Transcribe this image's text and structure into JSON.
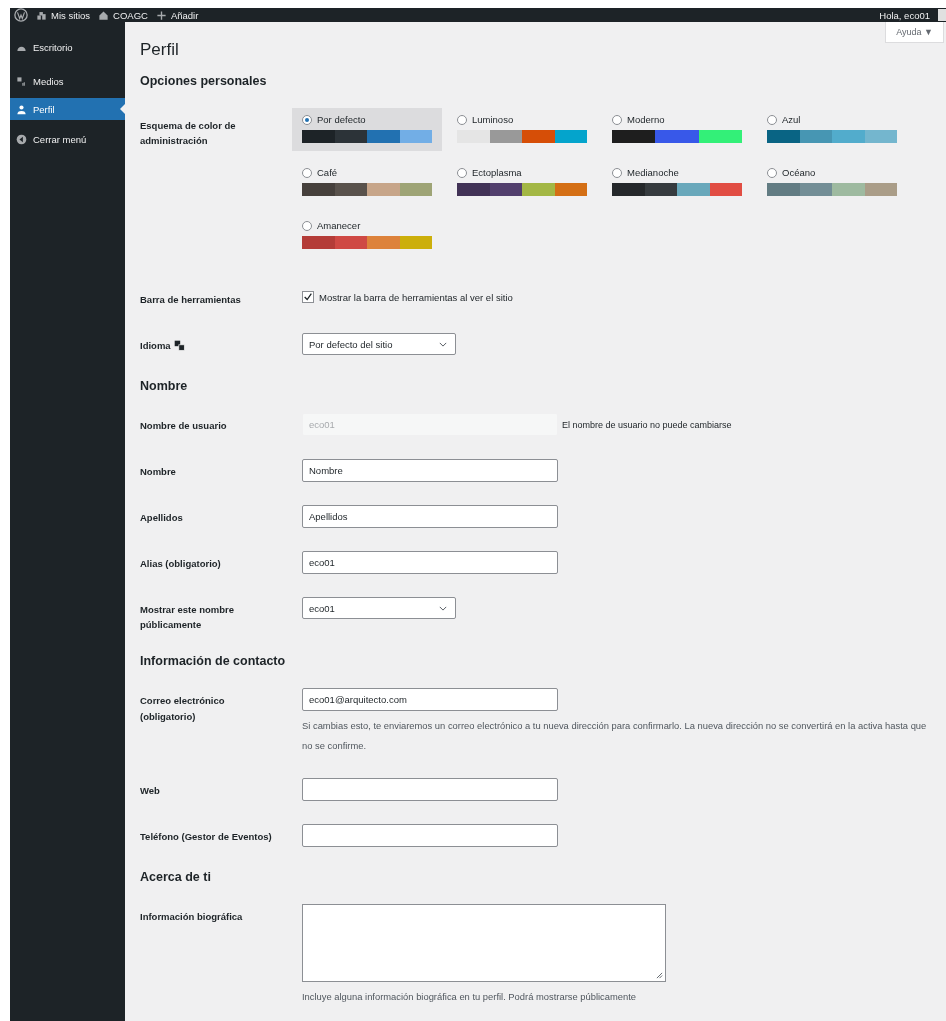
{
  "admin_bar": {
    "items": [
      {
        "kind": "wp"
      },
      {
        "kind": "sites",
        "label": "Mis sitios"
      },
      {
        "kind": "home",
        "label": "COAGC"
      },
      {
        "kind": "add",
        "label": "Añadir"
      }
    ],
    "greeting": "Hola, eco01"
  },
  "sidebar": {
    "items": [
      {
        "kind": "dashboard",
        "label": "Escritorio",
        "selected": false
      },
      {
        "kind": "media",
        "label": "Medios",
        "selected": false
      },
      {
        "kind": "user",
        "label": "Perfil",
        "selected": true
      },
      {
        "kind": "collapse",
        "label": "Cerrar menú",
        "selected": false
      }
    ]
  },
  "help_button": "Ayuda ▼",
  "title": "Perfil",
  "sections": [
    {
      "title": "Opciones personales",
      "rows": [
        {
          "kind": "schemes",
          "label": "Esquema de color de administración",
          "schemes": [
            {
              "name": "Por defecto",
              "selected": true,
              "swatches": [
                {
                  "color": "#1d2327"
                },
                {
                  "color": "#2c3338"
                },
                {
                  "color": "#2271b1"
                },
                {
                  "color": "#72aee6"
                }
              ]
            },
            {
              "name": "Luminoso",
              "selected": false,
              "swatches": [
                {
                  "color": "#e5e5e5"
                },
                {
                  "color": "#999999"
                },
                {
                  "color": "#d64e07"
                },
                {
                  "color": "#04a4cc"
                }
              ]
            },
            {
              "name": "Moderno",
              "selected": false,
              "swatches": [
                {
                  "color": "#1e1e1e"
                },
                {
                  "color": "#3858e9"
                },
                {
                  "color": "#33f078"
                }
              ]
            },
            {
              "name": "Azul",
              "selected": false,
              "swatches": [
                {
                  "color": "#096484"
                },
                {
                  "color": "#4796b3"
                },
                {
                  "color": "#52accc"
                },
                {
                  "color": "#74b6ce"
                }
              ]
            },
            {
              "name": "Café",
              "selected": false,
              "swatches": [
                {
                  "color": "#46403c"
                },
                {
                  "color": "#59524c"
                },
                {
                  "color": "#c7a589"
                },
                {
                  "color": "#9ea476"
                }
              ]
            },
            {
              "name": "Ectoplasma",
              "selected": false,
              "swatches": [
                {
                  "color": "#413256"
                },
                {
                  "color": "#523f6d"
                },
                {
                  "color": "#a3b745"
                },
                {
                  "color": "#d46f15"
                }
              ]
            },
            {
              "name": "Medianoche",
              "selected": false,
              "swatches": [
                {
                  "color": "#25282b"
                },
                {
                  "color": "#363b3f"
                },
                {
                  "color": "#69a8bb"
                },
                {
                  "color": "#e14d43"
                }
              ]
            },
            {
              "name": "Océano",
              "selected": false,
              "swatches": [
                {
                  "color": "#627c83"
                },
                {
                  "color": "#738e96"
                },
                {
                  "color": "#9ebaa0"
                },
                {
                  "color": "#aa9d88"
                }
              ]
            },
            {
              "name": "Amanecer",
              "selected": false,
              "swatches": [
                {
                  "color": "#b43c38"
                },
                {
                  "color": "#cf4944"
                },
                {
                  "color": "#dd823b"
                },
                {
                  "color": "#ccaf0b"
                }
              ]
            }
          ]
        },
        {
          "kind": "checkbox",
          "label": "Barra de herramientas",
          "text": "Mostrar la barra de herramientas al ver el sitio",
          "checked": true
        },
        {
          "kind": "language",
          "label": "Idioma",
          "value": "Por defecto del sitio"
        }
      ]
    },
    {
      "title": "Nombre",
      "rows": [
        {
          "kind": "text",
          "label": "Nombre de usuario",
          "value": "eco01",
          "disabled": true,
          "side_note": "El nombre de usuario no puede cambiarse"
        },
        {
          "kind": "text",
          "label": "Nombre",
          "value": "Nombre",
          "disabled": false
        },
        {
          "kind": "text",
          "label": "Apellidos",
          "value": "Apellidos",
          "disabled": false
        },
        {
          "kind": "text",
          "label": "Alias (obligatorio)",
          "value": "eco01",
          "disabled": false
        },
        {
          "kind": "select",
          "label": "Mostrar este nombre públicamente",
          "value": "eco01"
        }
      ]
    },
    {
      "title": "Información de contacto",
      "rows": [
        {
          "kind": "text",
          "label": "Correo electrónico (obligatorio)",
          "value": "eco01@arquitecto.com",
          "disabled": false,
          "note": "Si cambias esto, te enviaremos un correo electrónico a tu nueva dirección para confirmarlo. La nueva dirección no se convertirá en la activa hasta que no se confirme."
        },
        {
          "kind": "text",
          "label": "Web",
          "disabled": false
        },
        {
          "kind": "text",
          "label": "Teléfono (Gestor de Eventos)",
          "disabled": false
        }
      ]
    },
    {
      "title": "Acerca de ti",
      "rows": [
        {
          "kind": "textarea",
          "label": "Información biográfica",
          "note": "Incluye alguna información biográfica en tu perfil. Podrá mostrarse públicamente"
        }
      ]
    }
  ]
}
